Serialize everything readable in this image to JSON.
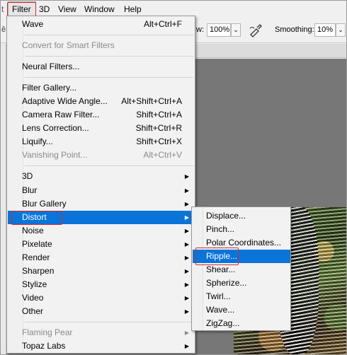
{
  "menubar": {
    "items": [
      "Filter",
      "3D",
      "View",
      "Window",
      "Help"
    ]
  },
  "options_bar": {
    "flow_label": "w:",
    "flow_value": "100%",
    "smoothing_label": "Smoothing:",
    "smoothing_value": "10%"
  },
  "filter_menu": {
    "last_filter": {
      "label": "Wave",
      "shortcut": "Alt+Ctrl+F"
    },
    "convert_smart": "Convert for Smart Filters",
    "neural": "Neural Filters...",
    "group1": [
      {
        "label": "Filter Gallery...",
        "shortcut": ""
      },
      {
        "label": "Adaptive Wide Angle...",
        "shortcut": "Alt+Shift+Ctrl+A"
      },
      {
        "label": "Camera Raw Filter...",
        "shortcut": "Shift+Ctrl+A"
      },
      {
        "label": "Lens Correction...",
        "shortcut": "Shift+Ctrl+R"
      },
      {
        "label": "Liquify...",
        "shortcut": "Shift+Ctrl+X"
      },
      {
        "label": "Vanishing Point...",
        "shortcut": "Alt+Ctrl+V"
      }
    ],
    "group2": [
      "3D",
      "Blur",
      "Blur Gallery",
      "Distort",
      "Noise",
      "Pixelate",
      "Render",
      "Sharpen",
      "Stylize",
      "Video",
      "Other"
    ],
    "group3": [
      "Flaming Pear",
      "Topaz Labs"
    ]
  },
  "distort_submenu": {
    "items": [
      "Displace...",
      "Pinch...",
      "Polar Coordinates...",
      "Ripple...",
      "Shear...",
      "Spherize...",
      "Twirl...",
      "Wave...",
      "ZigZag..."
    ]
  },
  "colors": {
    "highlight": "#0a74d9",
    "annotation": "#d42a2a"
  }
}
